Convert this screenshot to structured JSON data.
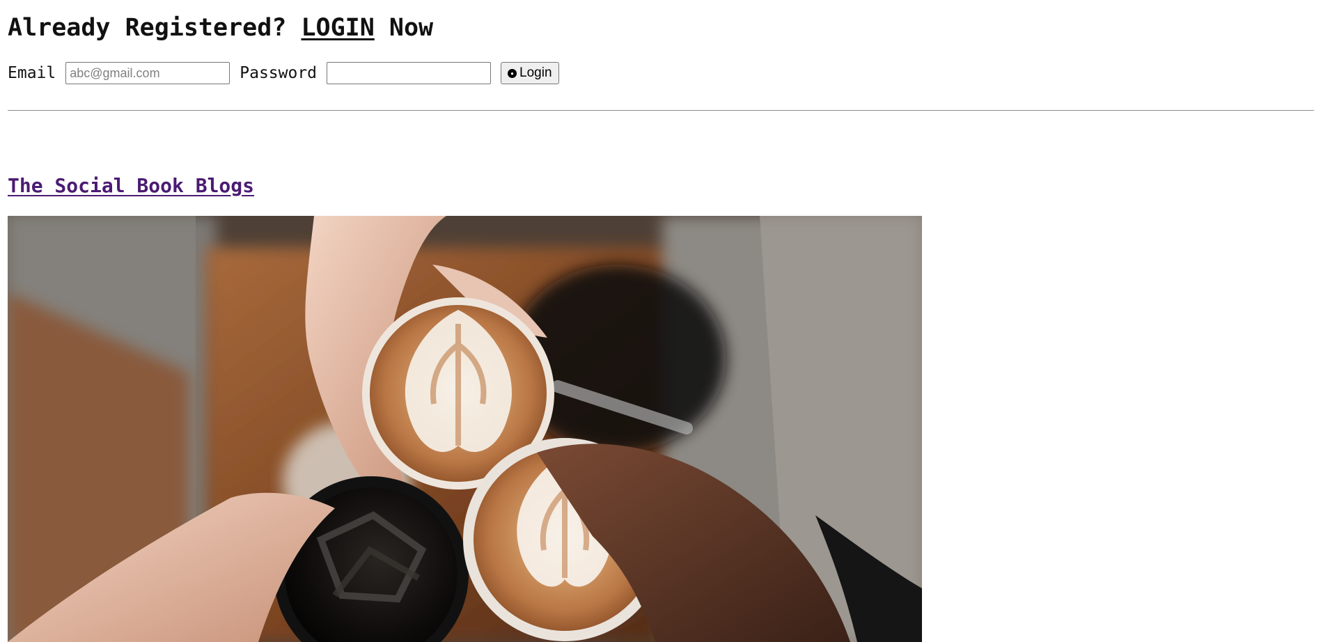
{
  "header": {
    "prefix": "Already Registered? ",
    "login_link": "LOGIN",
    "suffix": " Now"
  },
  "login_form": {
    "email_label": "Email",
    "email_placeholder": "abc@gmail.com",
    "email_value": "",
    "password_label": "Password",
    "password_value": "",
    "login_button_label": "Login",
    "login_icon": "circle-dot-icon"
  },
  "blog": {
    "title": "The Social Book Blogs"
  },
  "hero_image": {
    "subject": "photo",
    "icon_name": "coffee-cups-photo"
  },
  "colors": {
    "page_background": "#ffffff",
    "text": "#111111",
    "blog_link": "#4b1b73",
    "divider": "#8b8b8b",
    "scrollbar_thumb": "#c1c1c1"
  }
}
